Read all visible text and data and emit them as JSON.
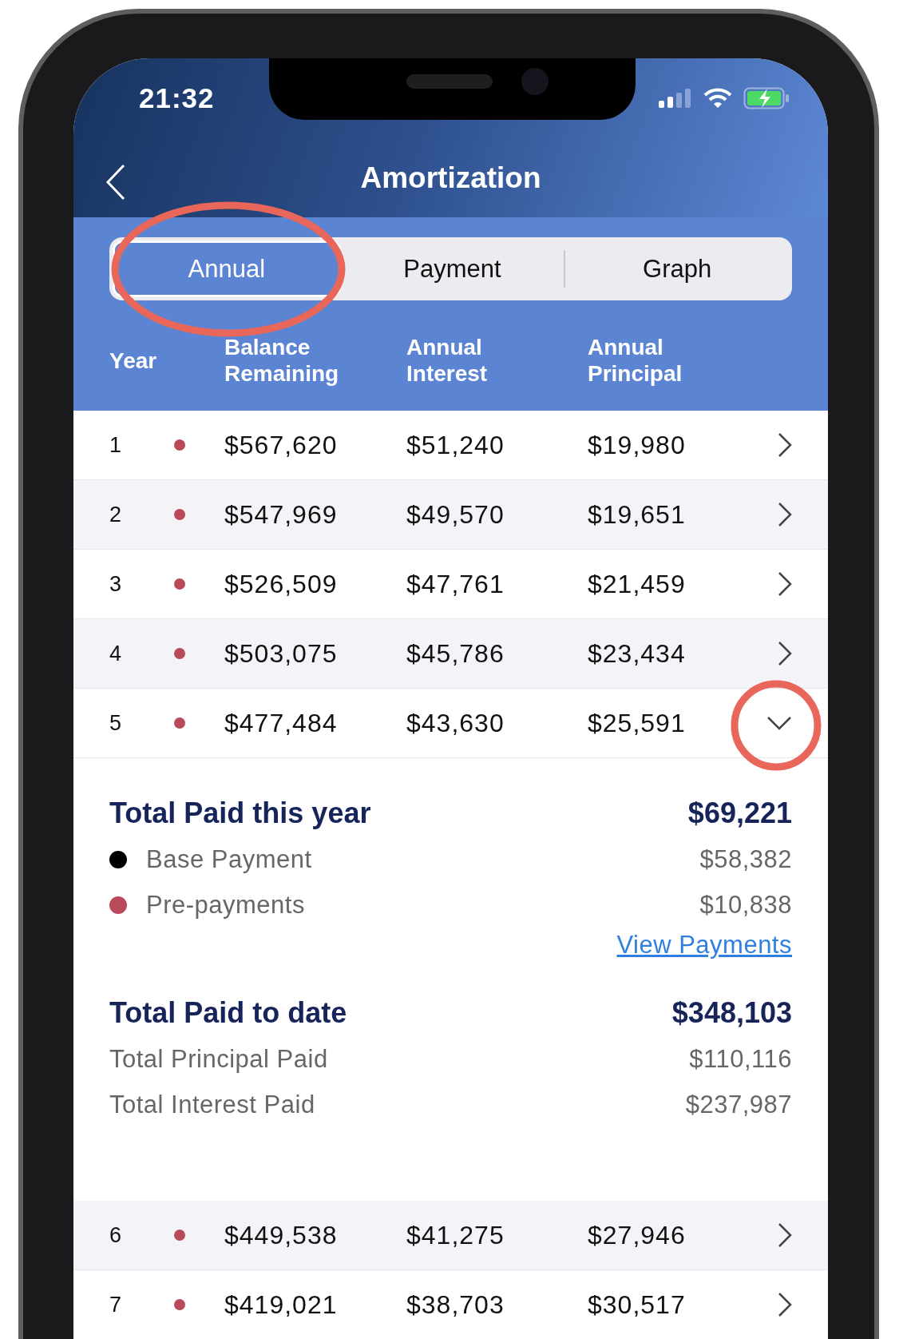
{
  "status_bar": {
    "time": "21:32"
  },
  "nav": {
    "title": "Amortization"
  },
  "tabs": [
    {
      "label": "Annual",
      "selected": true
    },
    {
      "label": "Payment",
      "selected": false
    },
    {
      "label": "Graph",
      "selected": false
    }
  ],
  "columns": [
    "Year",
    "Balance Remaining",
    "Annual Interest",
    "Annual Principal"
  ],
  "rows": [
    {
      "year": "1",
      "prepayment": true,
      "balance": "$567,620",
      "interest": "$51,240",
      "principal": "$19,980",
      "expanded": false
    },
    {
      "year": "2",
      "prepayment": true,
      "balance": "$547,969",
      "interest": "$49,570",
      "principal": "$19,651",
      "expanded": false
    },
    {
      "year": "3",
      "prepayment": true,
      "balance": "$526,509",
      "interest": "$47,761",
      "principal": "$21,459",
      "expanded": false
    },
    {
      "year": "4",
      "prepayment": true,
      "balance": "$503,075",
      "interest": "$45,786",
      "principal": "$23,434",
      "expanded": false
    },
    {
      "year": "5",
      "prepayment": true,
      "balance": "$477,484",
      "interest": "$43,630",
      "principal": "$25,591",
      "expanded": true
    },
    {
      "year": "6",
      "prepayment": true,
      "balance": "$449,538",
      "interest": "$41,275",
      "principal": "$27,946",
      "expanded": false
    },
    {
      "year": "7",
      "prepayment": true,
      "balance": "$419,021",
      "interest": "$38,703",
      "principal": "$30,517",
      "expanded": false
    }
  ],
  "year_detail": {
    "title": "Total Paid this year",
    "total": "$69,221",
    "items": [
      {
        "label": "Base Payment",
        "value": "$58,382",
        "color": "#000000"
      },
      {
        "label": "Pre-payments",
        "value": "$10,838",
        "color": "#b94a5a"
      }
    ],
    "link": "View Payments"
  },
  "to_date": {
    "title": "Total Paid to date",
    "total": "$348,103",
    "items": [
      {
        "label": "Total Principal Paid",
        "value": "$110,116"
      },
      {
        "label": "Total Interest Paid",
        "value": "$237,987"
      }
    ]
  }
}
